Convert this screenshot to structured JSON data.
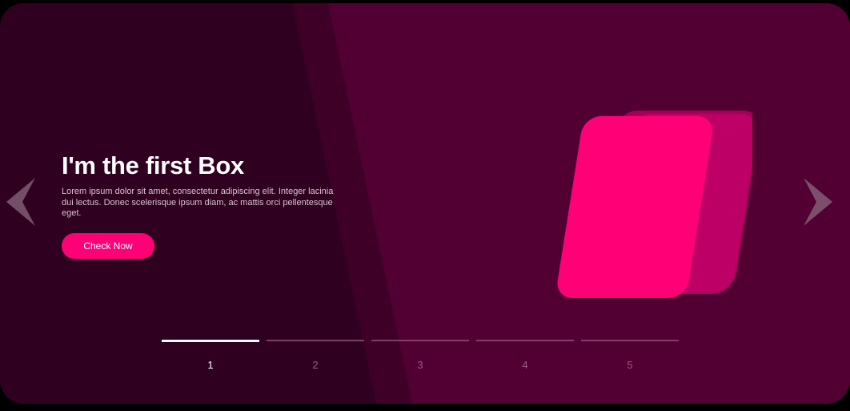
{
  "slide": {
    "title": "I'm the first Box",
    "description": "Lorem ipsum dolor sit amet, consectetur adipiscing elit. Integer lacinia dui lectus. Donec scelerisque ipsum diam, ac mattis orci pellentesque eget.",
    "button_label": "Check Now"
  },
  "navigation": {
    "prev_icon": "chevron-left-icon",
    "next_icon": "chevron-right-icon"
  },
  "pagination": {
    "pages": [
      "1",
      "2",
      "3",
      "4",
      "5"
    ],
    "active_index": 0
  },
  "colors": {
    "background": "#520033",
    "shadow": "#2f001f",
    "accent": "#ff0077"
  }
}
